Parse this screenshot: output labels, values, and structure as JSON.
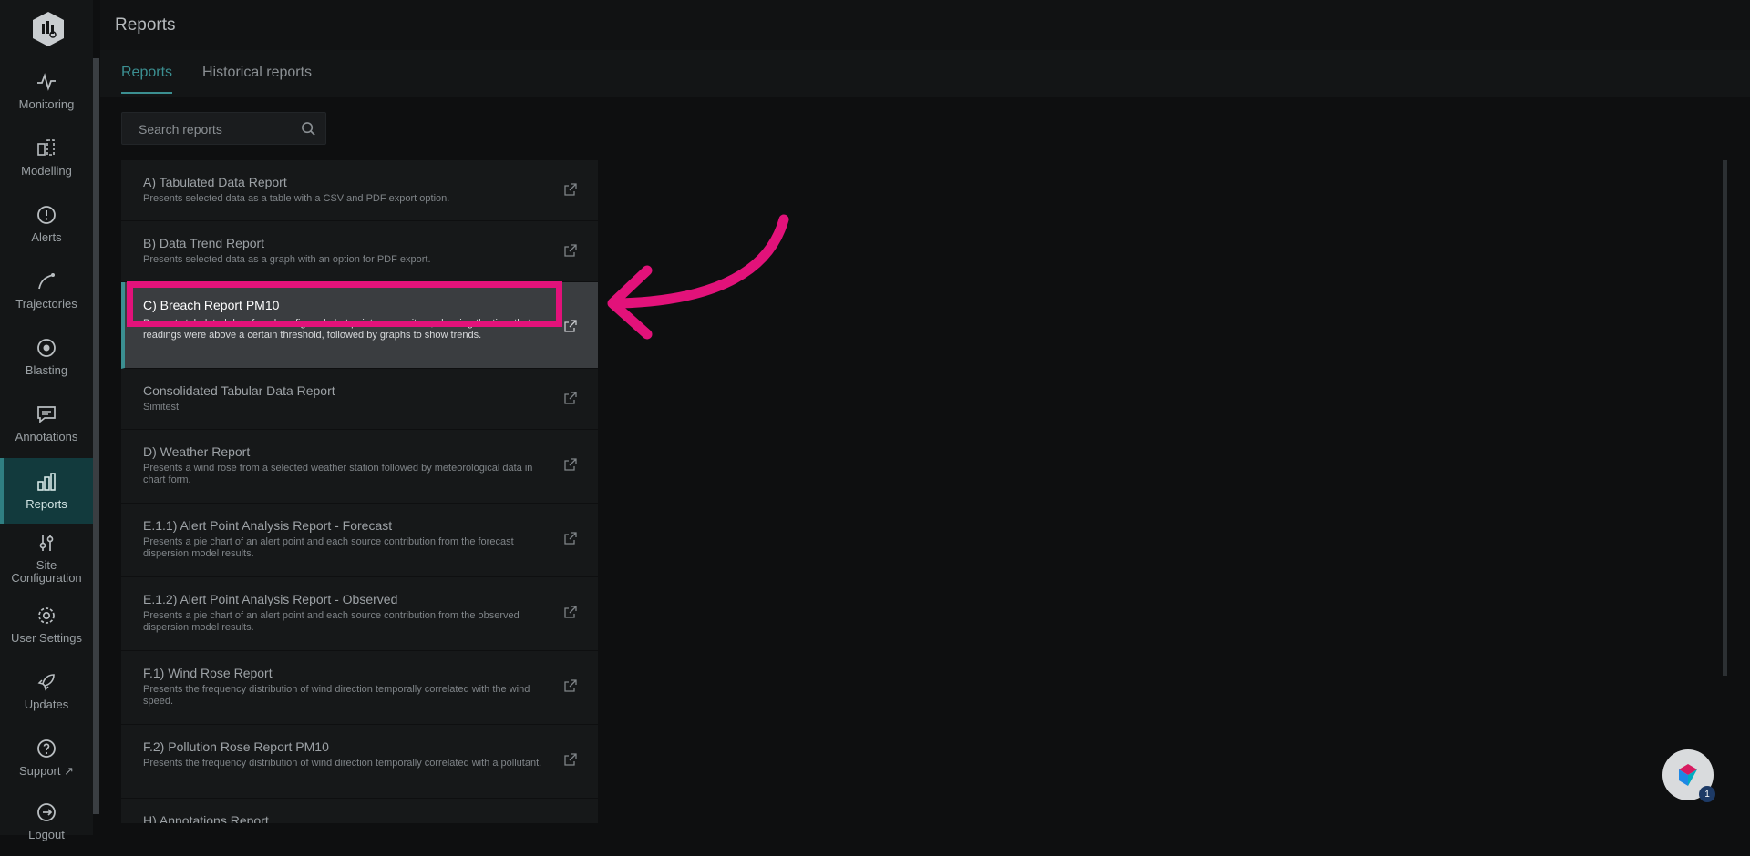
{
  "header": {
    "title": "Reports"
  },
  "tabs": [
    {
      "label": "Reports",
      "active": true
    },
    {
      "label": "Historical reports",
      "active": false
    }
  ],
  "search": {
    "placeholder": "Search reports"
  },
  "sidebar": {
    "items": [
      {
        "label": "Monitoring",
        "icon": "pulse-icon"
      },
      {
        "label": "Modelling",
        "icon": "modelling-icon"
      },
      {
        "label": "Alerts",
        "icon": "alert-circle-icon"
      },
      {
        "label": "Trajectories",
        "icon": "trajectory-icon"
      },
      {
        "label": "Blasting",
        "icon": "target-icon"
      },
      {
        "label": "Annotations",
        "icon": "comment-icon"
      },
      {
        "label": "Reports",
        "icon": "bar-chart-icon",
        "active": true
      },
      {
        "label": "Site Configuration",
        "icon": "sliders-icon"
      },
      {
        "label": "User Settings",
        "icon": "gear-icon"
      },
      {
        "label": "Updates",
        "icon": "rocket-icon"
      },
      {
        "label": "Support",
        "icon": "help-circle-icon"
      },
      {
        "label": "Logout",
        "icon": "logout-icon"
      }
    ]
  },
  "reports": [
    {
      "title": "A) Tabulated Data Report",
      "desc": "Presents selected data as a table with a CSV and PDF export option."
    },
    {
      "title": "B) Data Trend Report",
      "desc": "Presents selected data as a graph with an option for PDF export."
    },
    {
      "title": "C) Breach Report PM10",
      "desc": "Presents tabulated data for all configured alert points or monitors, showing the time that readings were above a certain threshold, followed by graphs to show trends.",
      "selected": true
    },
    {
      "title": "Consolidated Tabular Data Report",
      "desc": "Simitest"
    },
    {
      "title": "D) Weather Report",
      "desc": "Presents a wind rose from a selected weather station followed by meteorological data in chart form."
    },
    {
      "title": "E.1.1) Alert Point Analysis Report - Forecast",
      "desc": "Presents a pie chart of an alert point and each source contribution from the forecast dispersion model results."
    },
    {
      "title": "E.1.2) Alert Point Analysis Report - Observed",
      "desc": "Presents a pie chart of an alert point and each source contribution from the observed dispersion model results."
    },
    {
      "title": "F.1) Wind Rose Report",
      "desc": "Presents the frequency distribution of wind direction temporally correlated with the wind speed."
    },
    {
      "title": "F.2) Pollution Rose Report PM10",
      "desc": "Presents the frequency distribution of wind direction temporally correlated with a pollutant."
    },
    {
      "title": "H) Annotations Report",
      "desc": ""
    }
  ],
  "help": {
    "badge": "1"
  },
  "colors": {
    "accent": "#3b8f91",
    "annotation": "#e2127a",
    "active_nav": "#123a3d"
  }
}
